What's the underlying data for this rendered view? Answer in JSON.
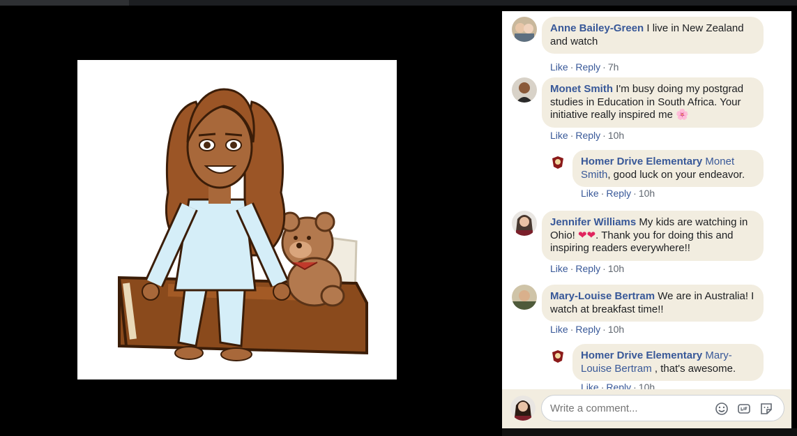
{
  "comments": [
    {
      "author": "Anne Bailey-Green",
      "text": " I live in New Zealand and watch",
      "like": "Like",
      "reply": "Reply",
      "time": "7h"
    },
    {
      "author": "Monet Smith",
      "text": " I'm busy doing my postgrad studies in Education in South Africa. Your initiative really inspired me ",
      "emoji": "🌸",
      "like": "Like",
      "reply": "Reply",
      "time": "10h",
      "reply_item": {
        "author": "Homer Drive Elementary",
        "mention": " Monet Smith",
        "text": ", good luck on your endeavor.",
        "like": "Like",
        "reply": "Reply",
        "time": "10h"
      }
    },
    {
      "author": "Jennifer Williams",
      "text_before": " My kids are watching in Ohio! ",
      "emoji": "❤❤",
      "text_after": ". Thank you for doing this and inspiring readers everywhere!!",
      "like": "Like",
      "reply": "Reply",
      "time": "10h"
    },
    {
      "author": "Mary-Louise Bertram",
      "text": " We are in Australia! I watch at breakfast time!!",
      "like": "Like",
      "reply": "Reply",
      "time": "10h",
      "reply_item": {
        "author": "Homer Drive Elementary",
        "mention": " Mary-Louise Bertram",
        "text": " , that's awesome.",
        "like": "Like",
        "reply": "Reply",
        "time": "10h"
      }
    }
  ],
  "composer": {
    "placeholder": "Write a comment...",
    "icons": [
      "emoji-icon",
      "gif-icon",
      "sticker-icon"
    ]
  },
  "colors": {
    "bubble": "#f2ede0",
    "link": "#385898",
    "meta": "#606770"
  }
}
